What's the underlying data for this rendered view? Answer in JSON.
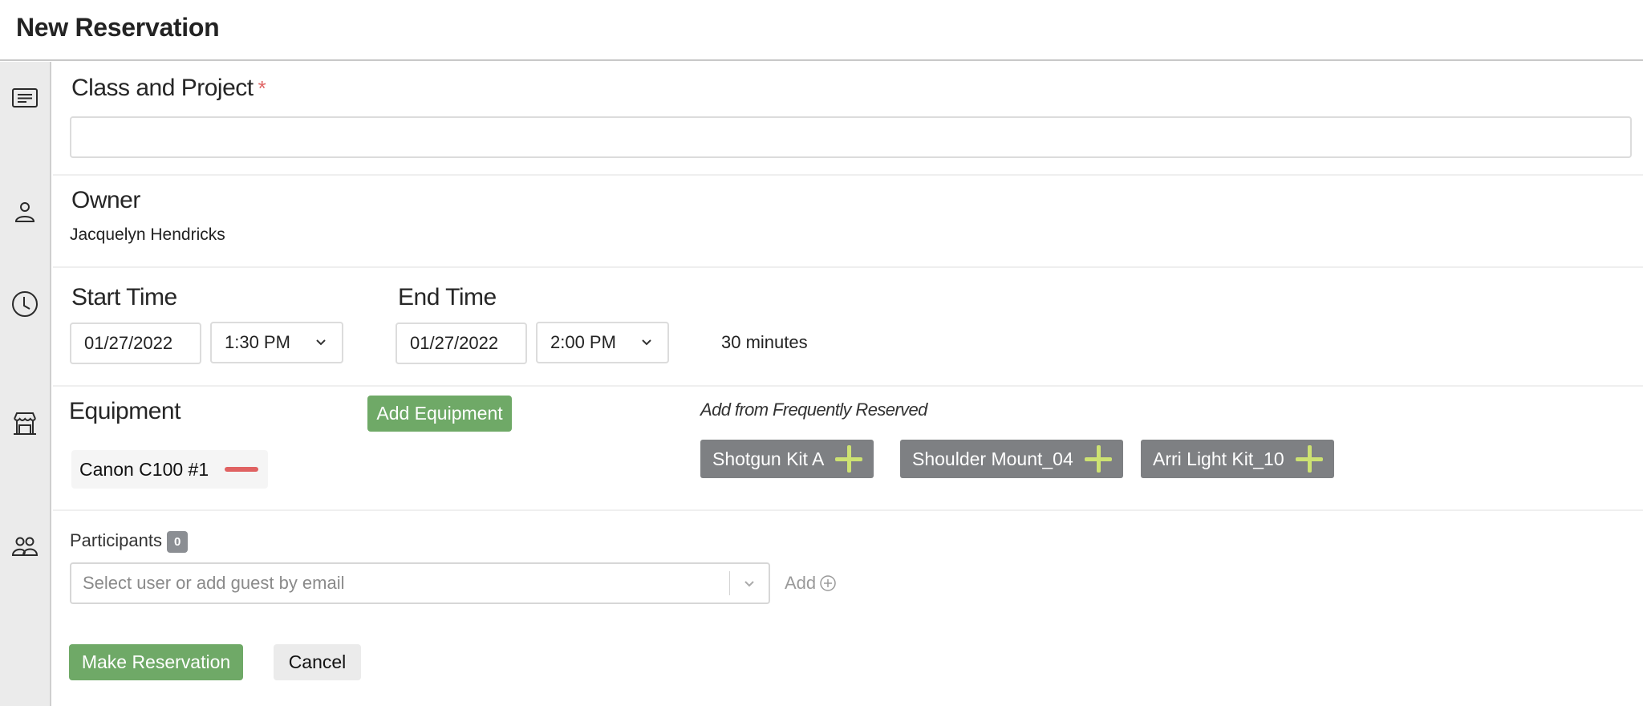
{
  "header": {
    "title": "New Reservation"
  },
  "sidebar": {
    "icons": [
      "description-icon",
      "person-icon",
      "clock-icon",
      "storefront-icon",
      "group-icon"
    ]
  },
  "class_project": {
    "label": "Class and Project",
    "required_mark": "*",
    "value": ""
  },
  "owner": {
    "label": "Owner",
    "name": "Jacquelyn Hendricks"
  },
  "time": {
    "start_label": "Start Time",
    "start_date": "01/27/2022",
    "start_time": "1:30 PM",
    "end_label": "End Time",
    "end_date": "01/27/2022",
    "end_time": "2:00 PM",
    "duration": "30 minutes"
  },
  "equipment": {
    "label": "Equipment",
    "add_button": "Add Equipment",
    "selected": [
      {
        "name": "Canon C100 #1"
      }
    ],
    "frequent_label": "Add from Frequently Reserved",
    "frequent": [
      {
        "name": "Shotgun Kit A"
      },
      {
        "name": "Shoulder Mount_04"
      },
      {
        "name": "Arri Light Kit_10"
      }
    ]
  },
  "participants": {
    "label": "Participants",
    "count": "0",
    "placeholder": "Select user or add guest by email",
    "add_label": "Add"
  },
  "actions": {
    "submit": "Make Reservation",
    "cancel": "Cancel"
  },
  "colors": {
    "primary_green": "#6fa967",
    "remove_red": "#e06262",
    "chip_grey": "#7e8083",
    "plus_lime": "#cde272",
    "required_red": "#e06666"
  }
}
